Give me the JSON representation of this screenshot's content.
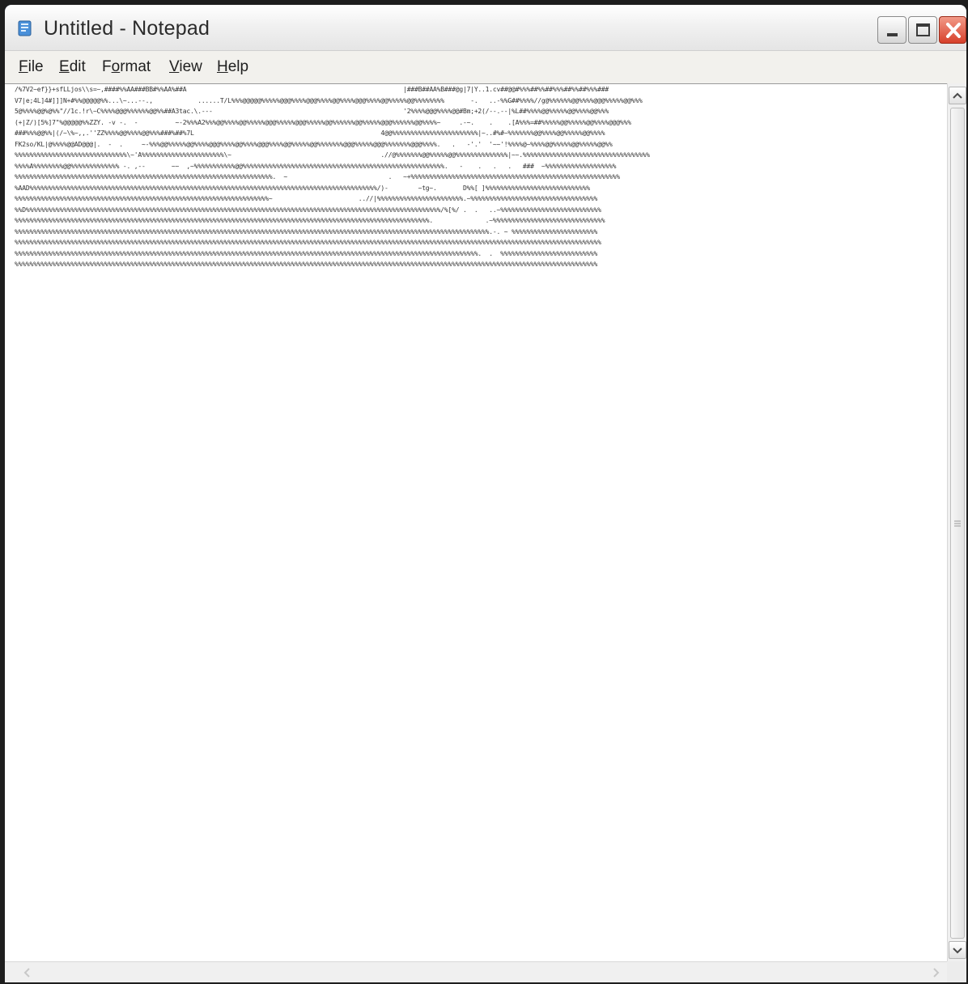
{
  "window": {
    "title": "Untitled - Notepad",
    "app_icon": "notepad-icon",
    "controls": [
      "minimize-icon",
      "maximize-icon",
      "close-icon"
    ]
  },
  "menu": {
    "items": [
      {
        "label": "File",
        "mnemonic": "F",
        "rest": "ile"
      },
      {
        "label": "Edit",
        "mnemonic": "E",
        "rest": "dit"
      },
      {
        "label": "Format",
        "mnemonic": "o",
        "pre": "F",
        "rest": "rmat"
      },
      {
        "label": "View",
        "mnemonic": "V",
        "rest": "iew"
      },
      {
        "label": "Help",
        "mnemonic": "H",
        "rest": "elp"
      }
    ]
  },
  "editor": {
    "content": "/%7V2~ef}}+sfLLjos\\\\s=~,####%%AA###BB#%%AA%##A                                                          |###B##AA%B###@g|7|Y..1.cv##@@#%%%##%%##%%%##%%##%%%###\nV7|e;4L]4#]]]N+#%%@@@@@%%...\\~...--.,            ......T/L%%%@@@@@%%%%%@@@%%%%@@@%%%%@@%%%%@@@%%%%@@%%%%%@@%%%%%%%%       -.   ..-%%G##%%%%//g@%%%%%%@@%%%%@@@%%%%%@@%%%\n5@%%%%@@%@%%\"//1c.!r\\~C%%%%@@@%%%%%%@@%%##A3tac.\\.---                                                   '2%%%%@@@%%%%@@#Bm;+2(/--.--|%L##%%%%@@%%%%%@@%%%%@@%%%\n(+|Z/)[5%]7\"%@@@@@%%ZZY. -v -.  -          ~-2%%%A2%%%@@%%%%@@%%%%%@@@%%%%%@@@%%%%%@@%%%%%%@@%%%%%@@@%%%%%%@@%%%%~     .-~.    .    .[A%%%=##%%%%%@@%%%%%@@%%%%@@@%%%\n###%%%@@%%|(/~\\%~,,.''ZZ%%%%@@%%%%@@%%%###%##%7L                                                  4@@%%%%%%%%%%%%%%%%%%%%%%%|~..#%#~%%%%%%%@@%%%%@@%%%%%@@%%%%\nFK2so/KL|@%%%%@@AD@@@|.  -  .     ~-%%%@@%%%%%@@%%%%@@@%%%%@@%%%%@@@%%%%@@%%%%%@@%%%%%%%@@@%%%%%@@@%%%%%%%@@@%%%%.   .   -'.'  '~~'!%%%%@~%%%%@@%%%%%@@%%%%%@@%%\n%%%%%%%%%%%%%%%%%%%%%%%%%%%%%%\\~'A%%%%%%%%%%%%%%%%%%%%%%\\~                                        .//@%%%%%%%@@%%%%%@@%%%%%%%%%%%%%%|~~.%%%%%%%%%%%%%%%%%%%%%%%%%%%%%%%%%%\n%%%%A%%%%%%%%@@%%%%%%%%%%%%% -. ,--       ~~  ,~%%%%%%%%%%%@@%%%%%%%%%%%%%%%%%%%%%%%%%%%%%%%%%%%%%%%%%%%%%%%%%%%%%%.   -    .   .   .   ###  ~%%%%%%%%%%%%%%%%%%%\n%%%%%%%%%%%%%%%%%%%%%%%%%%%%%%%%%%%%%%%%%%%%%%%%%%%%%%%%%%%%%%%%%%%%%.  ~                           .   ~+%%%%%%%%%%%%%%%%%%%%%%%%%%%%%%%%%%%%%%%%%%%%%%%%%%%%%%%%\n%AAD%%%%%%%%%%%%%%%%%%%%%%%%%%%%%%%%%%%%%%%%%%%%%%%%%%%%%%%%%%%%%%%%%%%%%%%%%%%%%%%%%%%%%%%%%%%%%/)-        ~tg~.       D%%[ ]%%%%%%%%%%%%%%%%%%%%%%%%%%%%\n%%%%%%%%%%%%%%%%%%%%%%%%%%%%%%%%%%%%%%%%%%%%%%%%%%%%%%%%%%%%%%%%%%%%~                       ..//|%%%%%%%%%%%%%%%%%%%%%%%.~%%%%%%%%%%%%%%%%%%%%%%%%%%%%%%%%%%\n%%D%%%%%%%%%%%%%%%%%%%%%%%%%%%%%%%%%%%%%%%%%%%%%%%%%%%%%%%%%%%%%%%%%%%%%%%%%%%%%%%%%%%%%%%%%%%%%%%%%%%%%%%%%%%%%%%/%[%/ .  .   ..~%%%%%%%%%%%%%%%%%%%%%%%%%%%\n%%%%%%%%%%%%%%%%%%%%%%%%%%%%%%%%%%%%%%%%%%%%%%%%%%%%%%%%%%%%%%%%%%%%%%%%%%%%%%%%%%%%%%%%%%%%%%%%%%%%%%%%%%%%%%%.              .~%%%%%%%%%%%%%%%%%%%%%%%%%%%%%%\n%%%%%%%%%%%%%%%%%%%%%%%%%%%%%%%%%%%%%%%%%%%%%%%%%%%%%%%%%%%%%%%%%%%%%%%%%%%%%%%%%%%%%%%%%%%%%%%%%%%%%%%%%%%%%%%%%%%%%%%%%%%%%%%.-. ~ %%%%%%%%%%%%%%%%%%%%%%%\n%%%%%%%%%%%%%%%%%%%%%%%%%%%%%%%%%%%%%%%%%%%%%%%%%%%%%%%%%%%%%%%%%%%%%%%%%%%%%%%%%%%%%%%%%%%%%%%%%%%%%%%%%%%%%%%%%%%%%%%%%%%%%%%%%%%%%%%%%%%%%%%%%%%%%%%%%%%%%\n%%%%%%%%%%%%%%%%%%%%%%%%%%%%%%%%%%%%%%%%%%%%%%%%%%%%%%%%%%%%%%%%%%%%%%%%%%%%%%%%%%%%%%%%%%%%%%%%%%%%%%%%%%%%%%%%%%%%%%%%%%%%.  .  %%%%%%%%%%%%%%%%%%%%%%%%%%\n%%%%%%%%%%%%%%%%%%%%%%%%%%%%%%%%%%%%%%%%%%%%%%%%%%%%%%%%%%%%%%%%%%%%%%%%%%%%%%%%%%%%%%%%%%%%%%%%%%%%%%%%%%%%%%%%%%%%%%%%%%%%%%%%%%%%%%%%%%%%%%%%%%%%%%%%%%%%"
  },
  "scrollbar": {
    "up_icon": "chevron-up-icon",
    "down_icon": "chevron-down-icon",
    "left_icon": "chevron-left-icon",
    "right_icon": "chevron-right-icon"
  }
}
